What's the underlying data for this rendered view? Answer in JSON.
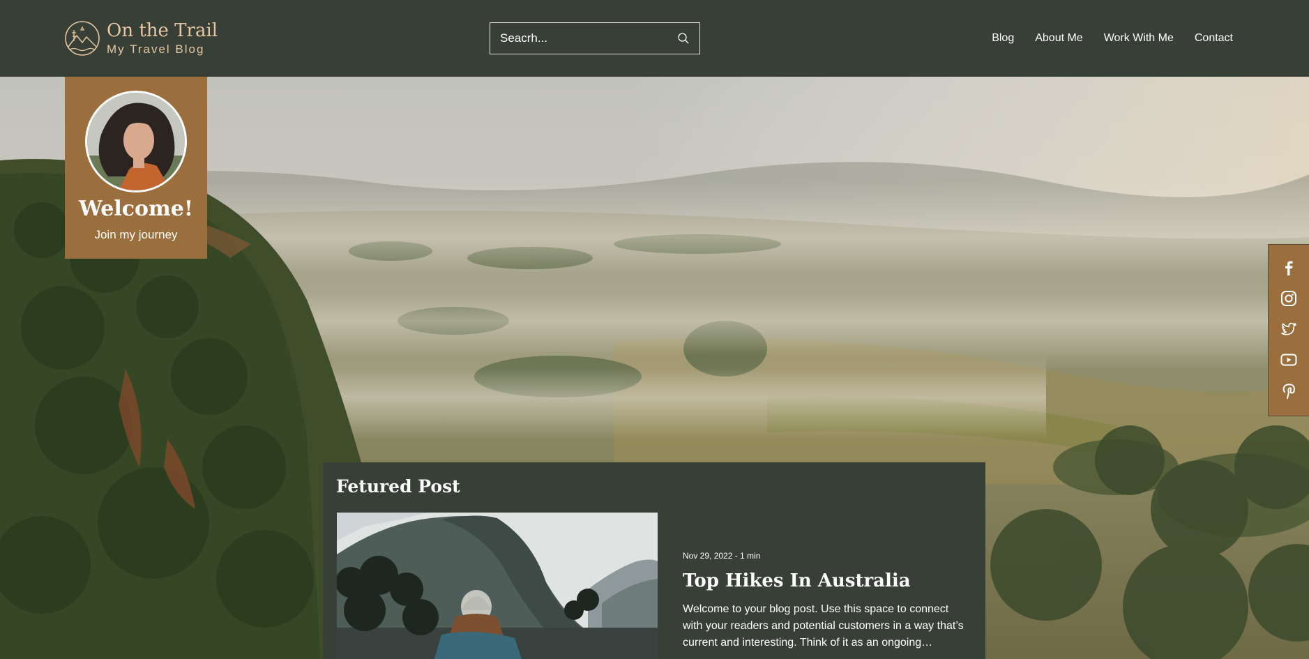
{
  "site": {
    "title": "On the Trail",
    "subtitle": "My Travel Blog",
    "brand_color": "#373f36",
    "accent_color": "#9b6e3e",
    "logo_text_color": "#e7c7a3"
  },
  "search": {
    "placeholder": "Seacrh..."
  },
  "nav": {
    "items": [
      {
        "label": "Blog"
      },
      {
        "label": "About Me"
      },
      {
        "label": "Work With Me"
      },
      {
        "label": "Contact"
      }
    ]
  },
  "welcome": {
    "title": "Welcome!",
    "subtitle": "Join my journey"
  },
  "social": {
    "icons": [
      "facebook-icon",
      "instagram-icon",
      "twitter-icon",
      "youtube-icon",
      "pinterest-icon"
    ]
  },
  "featured": {
    "heading": "Fetured Post",
    "post": {
      "meta": "Nov 29, 2022 - 1 min",
      "title": "Top Hikes In Australia",
      "excerpt": "Welcome to your blog post. Use this space to connect with your readers and potential customers in a way that’s current and interesting. Think of it as an ongoing…"
    }
  }
}
